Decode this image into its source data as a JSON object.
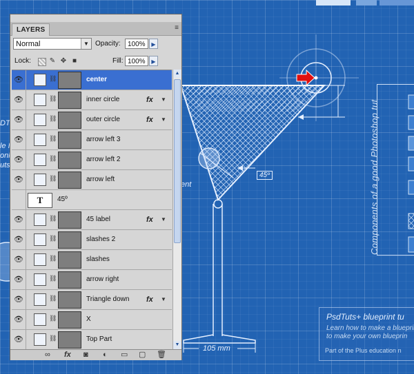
{
  "panel": {
    "tab_label": "LAYERS",
    "collapse_icon": "double-arrow-icon",
    "close_icon": "close-icon",
    "menu_icon": "panel-menu-icon",
    "blend_mode": "Normal",
    "opacity_label": "Opacity:",
    "opacity_value": "100%",
    "lock_label": "Lock:",
    "fill_label": "Fill:",
    "fill_value": "100%"
  },
  "layers": [
    {
      "name": "center",
      "selected": true,
      "type": "shape",
      "fx": false
    },
    {
      "name": "inner circle",
      "type": "shape",
      "fx": true
    },
    {
      "name": "outer circle",
      "type": "shape",
      "fx": true
    },
    {
      "name": "arrow left 3",
      "type": "shape",
      "fx": false
    },
    {
      "name": "arrow left 2",
      "type": "shape",
      "fx": false
    },
    {
      "name": "arrow left",
      "type": "shape",
      "fx": false
    },
    {
      "name": "45º",
      "type": "text",
      "fx": false
    },
    {
      "name": "45 label",
      "type": "shape",
      "fx": true
    },
    {
      "name": "slashes 2",
      "type": "shape",
      "fx": false
    },
    {
      "name": "slashes",
      "type": "shape",
      "fx": false
    },
    {
      "name": "arrow right",
      "type": "shape",
      "fx": false
    },
    {
      "name": "Triangle down",
      "type": "shape",
      "fx": true
    },
    {
      "name": "X",
      "type": "shape",
      "fx": false
    },
    {
      "name": "Top Part",
      "type": "shape",
      "fx": false
    }
  ],
  "fx_label": "fx",
  "text_layer_glyph": "T",
  "canvas": {
    "side_label": "Components of a good Photoshop tut",
    "dimension_width": "105 mm",
    "dimension_angle": "45º",
    "left_fragments": [
      "DT",
      "le I",
      "onl",
      "uts",
      "ent"
    ],
    "info_title": "PsdTuts+ blueprint tu",
    "info_lines": [
      "Learn how to make a blueprin",
      "to make your own blueprin"
    ],
    "info_footer": "Part of the Plus education n"
  },
  "colors": {
    "selection": "#3a6fd1",
    "blueprint": "#2263b3",
    "arrow_red": "#e01010"
  }
}
